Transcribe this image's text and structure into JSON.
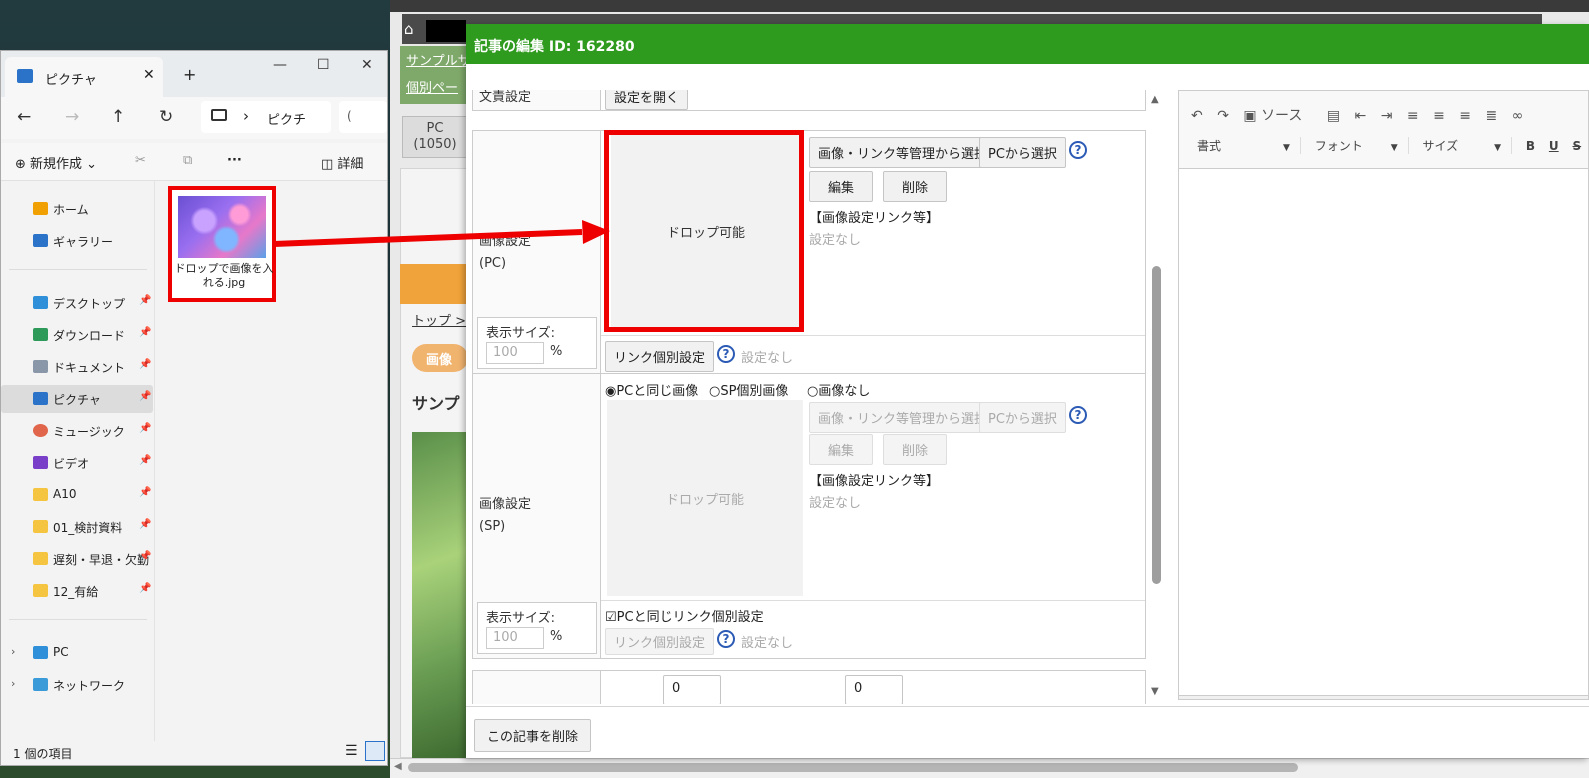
{
  "explorer": {
    "tab_title": "ピクチャ",
    "address": "ピクチ",
    "search_glyph": "(",
    "new_button": "新規作成",
    "details_button": "詳細",
    "sidebar": {
      "home": "ホーム",
      "gallery": "ギャラリー",
      "desktop": "デスクトップ",
      "downloads": "ダウンロード",
      "documents": "ドキュメント",
      "pictures": "ピクチャ",
      "music": "ミュージック",
      "videos": "ビデオ",
      "folder_a10": "A10",
      "folder_review": "01_検討資料",
      "folder_attendance": "遅刻・早退・欠勤",
      "folder_leave": "12_有給",
      "pc": "PC",
      "network": "ネットワーク"
    },
    "file": {
      "name": "ドロップで画像を入れる.jpg"
    },
    "status": "1 個の項目"
  },
  "cms": {
    "site_link": "サンプルサ",
    "page_link": "個別ペー",
    "device_label": "PC",
    "device_width": "(1050)",
    "breadcrumb": "トップ >",
    "pill": "画像",
    "heading": "サンプ"
  },
  "modal": {
    "title": "記事の編集 ID: 162280",
    "prev_row_label": "文責設定",
    "prev_row_button": "設定を開く",
    "pc": {
      "label_line1": "画像設定",
      "label_line2": "(PC)",
      "drop_text": "ドロップ可能",
      "select_manager_button": "画像・リンク等管理から選択",
      "select_pc_button": "PCから選択",
      "edit_button": "編集",
      "delete_button": "削除",
      "link_heading": "【画像設定リンク等】",
      "link_value": "設定なし",
      "size_label": "表示サイズ:",
      "size_value": "100",
      "size_unit": "%",
      "link_individual_button": "リンク個別設定",
      "link_individual_status": "設定なし"
    },
    "sp": {
      "label_line1": "画像設定",
      "label_line2": "(SP)",
      "radio_same": "PCと同じ画像",
      "radio_individual": "SP個別画像",
      "radio_none": "画像なし",
      "drop_text": "ドロップ可能",
      "select_manager_button": "画像・リンク等管理から選択",
      "select_pc_button": "PCから選択",
      "edit_button": "編集",
      "delete_button": "削除",
      "link_heading": "【画像設定リンク等】",
      "link_value": "設定なし",
      "size_label": "表示サイズ:",
      "size_value": "100",
      "size_unit": "%",
      "same_link_checkbox": "PCと同じリンク個別設定",
      "link_individual_button": "リンク個別設定",
      "link_individual_status": "設定なし"
    },
    "next_row_value_a": "0",
    "next_row_value_b": "0",
    "delete_article_button": "この記事を削除",
    "help_glyph": "?"
  },
  "editor": {
    "source_button": "ソース",
    "format_dropdown": "書式",
    "font_dropdown": "フォント",
    "size_dropdown": "サイズ",
    "bold": "B",
    "underline": "U",
    "strike": "S"
  },
  "colors": {
    "highlight": "#ee0000",
    "header_green": "#2e9a1e",
    "help_blue": "#2c5bb6"
  }
}
